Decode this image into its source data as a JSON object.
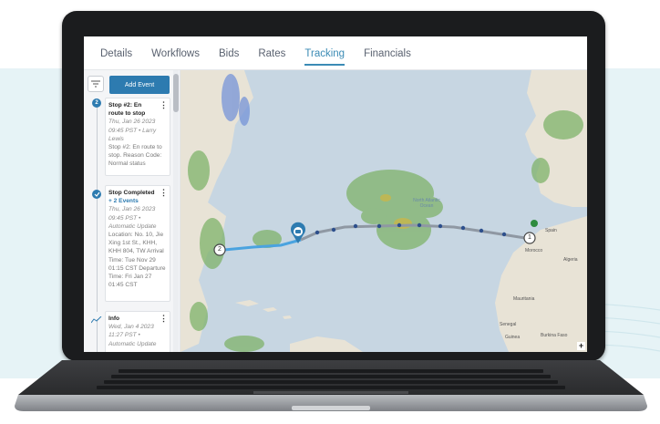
{
  "tabs": [
    {
      "label": "Details"
    },
    {
      "label": "Workflows"
    },
    {
      "label": "Bids"
    },
    {
      "label": "Rates"
    },
    {
      "label": "Tracking"
    },
    {
      "label": "Financials"
    }
  ],
  "active_tab": "Tracking",
  "sidebar": {
    "add_event_label": "Add Event",
    "marker_1": "2",
    "marker_3_icon": "trend-icon",
    "cards": [
      {
        "title": "Stop #2: En route to stop",
        "meta": "Thu, Jan 26 2023 09:45 PST • Larry Lewis",
        "body": "Stop #2: En route to stop. Reason Code: Normal status"
      },
      {
        "title": "Stop Completed",
        "events_link": "+ 2 Events",
        "meta": "Thu, Jan 26 2023 09:45 PST • Automatic Update",
        "body": "Location: No. 10, Jie Xing 1st St., KHH, KHH 804, TW Arrival Time: Tue Nov 29 01:15 CST Departure Time: Fri Jan 27 01:45 CST"
      },
      {
        "title": "Info",
        "meta": "Wed, Jan 4 2023 11:27 PST •",
        "body": "Automatic Update"
      }
    ]
  },
  "map": {
    "stop_labels": [
      "2",
      "1"
    ],
    "place_labels": [
      "North Atlantic Ocean",
      "Spain",
      "Morocco",
      "Algeria",
      "Mauritania",
      "Senegal",
      "Guinea",
      "Burkina Faso"
    ],
    "zoom_label": "+"
  },
  "colors": {
    "accent": "#3b8bb5",
    "button": "#2d7bb0",
    "route_traveled": "#4aa3df",
    "route_planned": "#8f98a3"
  }
}
